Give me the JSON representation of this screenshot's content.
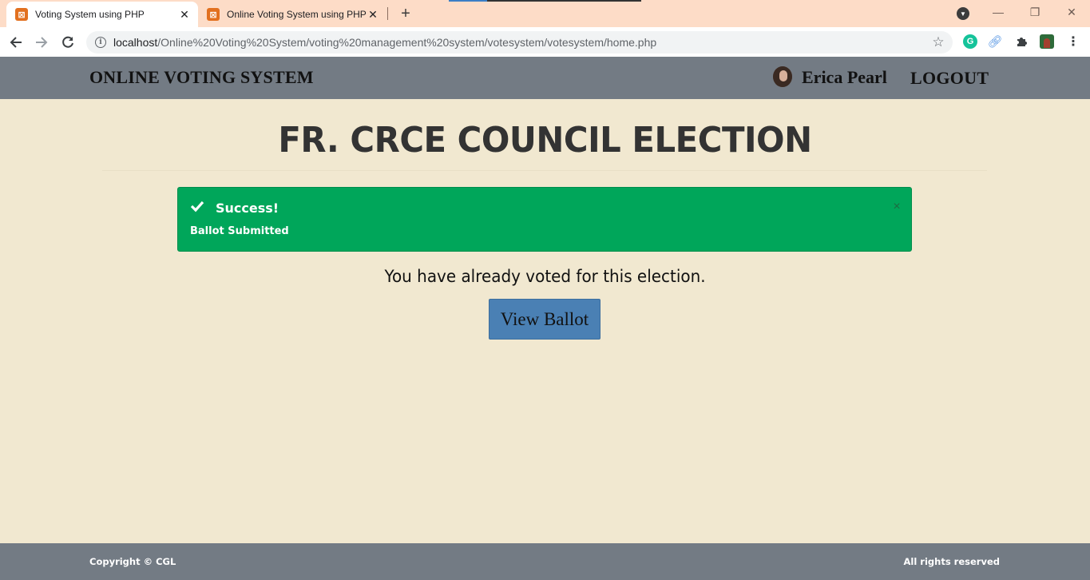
{
  "browser": {
    "tabs": [
      {
        "title": "Voting System using PHP",
        "active": true
      },
      {
        "title": "Online Voting System using PHP",
        "active": false
      }
    ],
    "new_tab_symbol": "+",
    "close_symbol": "✕",
    "url_host": "localhost",
    "url_path": "/Online%20Voting%20System/voting%20management%20system/votesystem/votesystem/home.php",
    "icons": {
      "back": "back-arrow-icon",
      "forward": "forward-arrow-icon",
      "reload": "reload-icon",
      "bookmark": "star-icon",
      "extensions": [
        "grammarly-icon",
        "link-icon",
        "puzzle-icon",
        "profile-icon",
        "kebab-menu-icon"
      ]
    }
  },
  "header": {
    "brand": "ONLINE VOTING SYSTEM",
    "user_name": "Erica Pearl",
    "logout_label": "LOGOUT"
  },
  "main": {
    "title": "FR. CRCE COUNCIL ELECTION",
    "alert": {
      "heading": "Success!",
      "message": "Ballot Submitted",
      "close_symbol": "×",
      "color": "#00a65a"
    },
    "voted_message": "You have already voted for this election.",
    "view_ballot_label": "View Ballot"
  },
  "footer": {
    "copyright": "Copyright © CGL",
    "rights": "All rights reserved"
  },
  "colors": {
    "page_bg": "#f1e8d0",
    "header_bg": "#737b84",
    "button_bg": "#4a80b4",
    "tabbar_bg": "#fddcc7"
  }
}
